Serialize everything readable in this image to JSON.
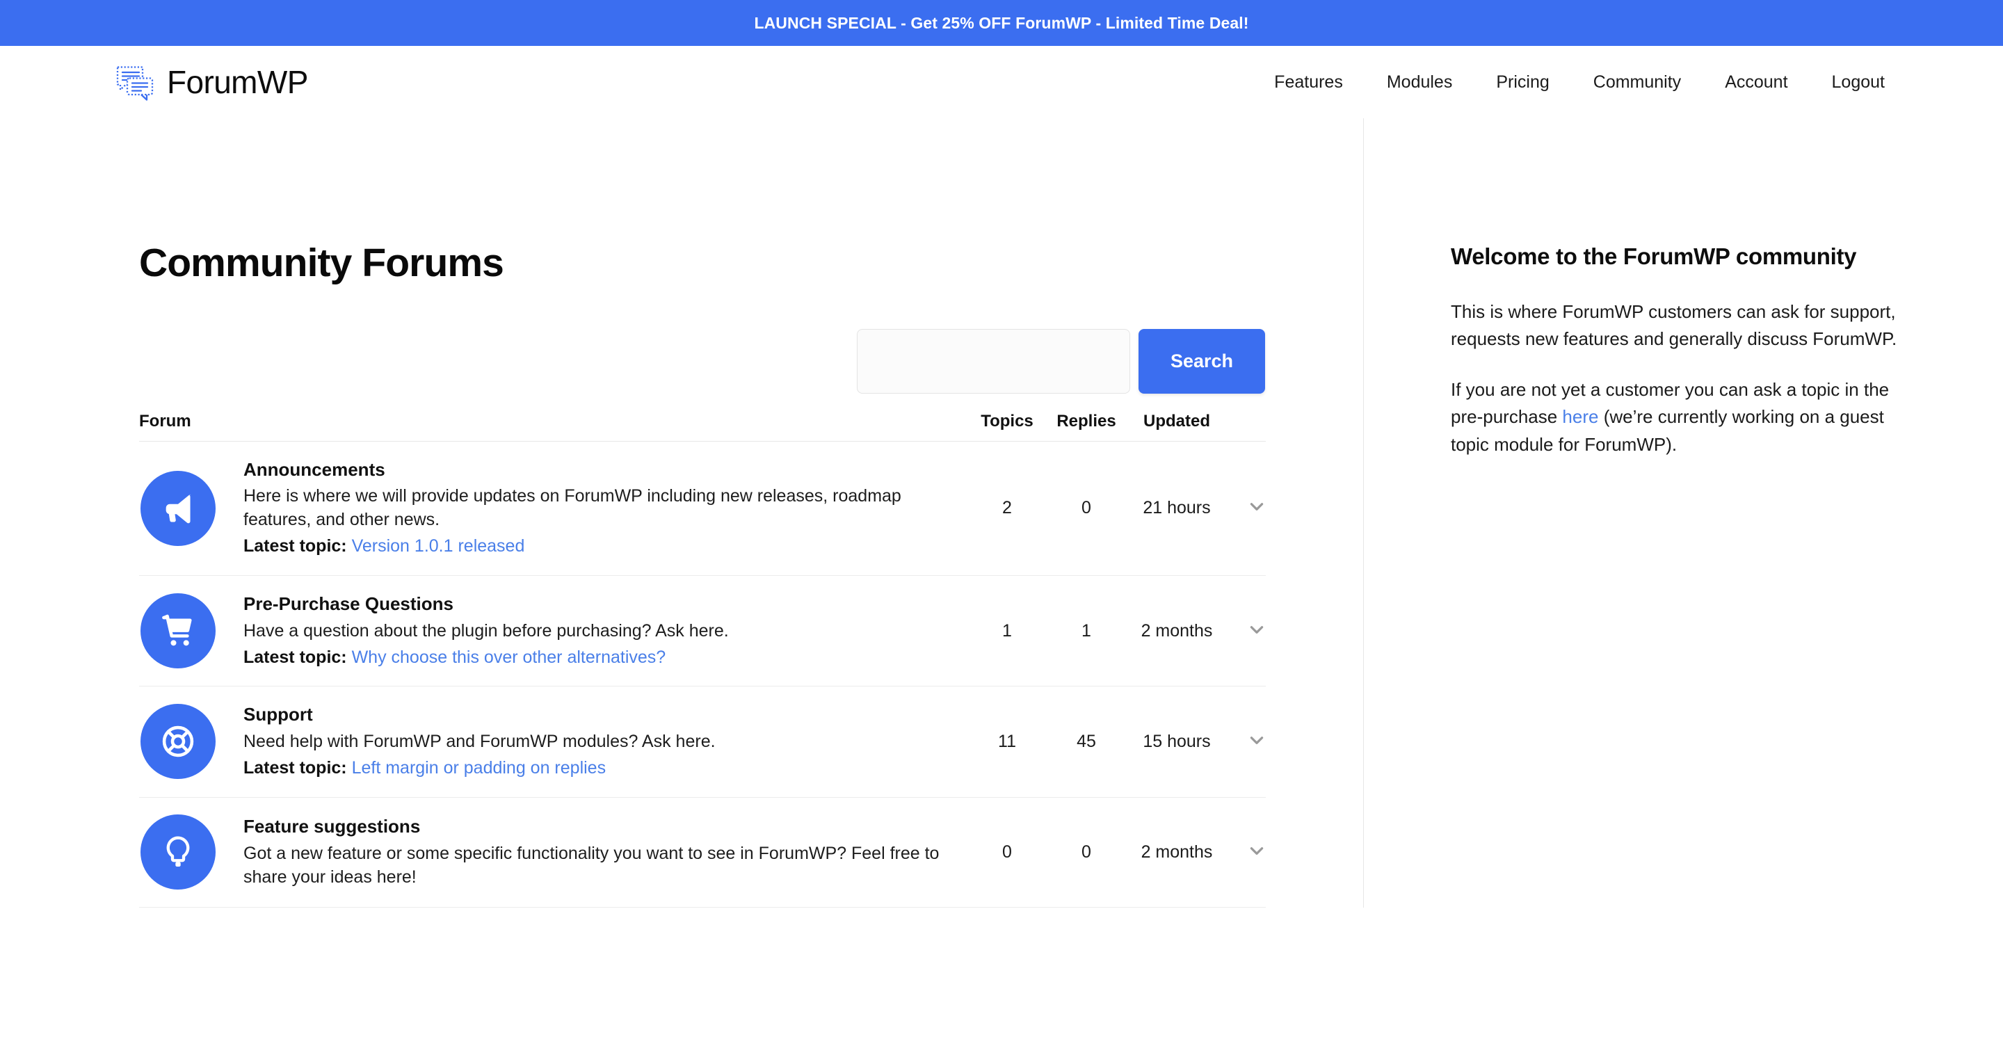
{
  "promo": {
    "text": "LAUNCH SPECIAL - Get 25% OFF ForumWP - Limited Time Deal!",
    "bg_color": "#3b6ef0"
  },
  "header": {
    "brand_name": "ForumWP",
    "logo_icon": "chat-bubbles-icon",
    "nav": [
      {
        "label": "Features"
      },
      {
        "label": "Modules"
      },
      {
        "label": "Pricing"
      },
      {
        "label": "Community"
      },
      {
        "label": "Account"
      },
      {
        "label": "Logout"
      }
    ]
  },
  "main": {
    "page_title": "Community Forums",
    "search": {
      "value": "",
      "placeholder": "",
      "button_label": "Search"
    },
    "table": {
      "columns": {
        "forum": "Forum",
        "topics": "Topics",
        "replies": "Replies",
        "updated": "Updated"
      },
      "latest_topic_label": "Latest topic:",
      "rows": [
        {
          "icon": "megaphone-icon",
          "name": "Announcements",
          "description": "Here is where we will provide updates on ForumWP including new releases, roadmap features, and other news.",
          "latest_topic": "Version 1.0.1 released",
          "topics": "2",
          "replies": "0",
          "updated": "21 hours"
        },
        {
          "icon": "shopping-cart-icon",
          "name": "Pre-Purchase Questions",
          "description": "Have a question about the plugin before purchasing? Ask here.",
          "latest_topic": "Why choose this over other alternatives?",
          "topics": "1",
          "replies": "1",
          "updated": "2 months"
        },
        {
          "icon": "life-ring-icon",
          "name": "Support",
          "description": "Need help with ForumWP and ForumWP modules? Ask here.",
          "latest_topic": "Left margin or padding on replies",
          "topics": "11",
          "replies": "45",
          "updated": "15 hours"
        },
        {
          "icon": "lightbulb-icon",
          "name": "Feature suggestions",
          "description": "Got a new feature or some specific functionality you want to see in ForumWP? Feel free to share your ideas here!",
          "latest_topic": "",
          "topics": "0",
          "replies": "0",
          "updated": "2 months"
        }
      ]
    }
  },
  "sidebar": {
    "title": "Welcome to the ForumWP community",
    "paragraph_1": "This is where ForumWP customers can ask for support, requests new features and generally discuss ForumWP.",
    "paragraph_2_before": "If you are not yet a customer you can ask a topic in the pre-purchase ",
    "paragraph_2_link": "here",
    "paragraph_2_after": " (we’re currently working on a guest topic module for ForumWP)."
  },
  "colors": {
    "accent": "#3b6ef0",
    "link": "#4a7fe8",
    "text": "#1b1b1b",
    "caret": "#9a9a9a"
  }
}
